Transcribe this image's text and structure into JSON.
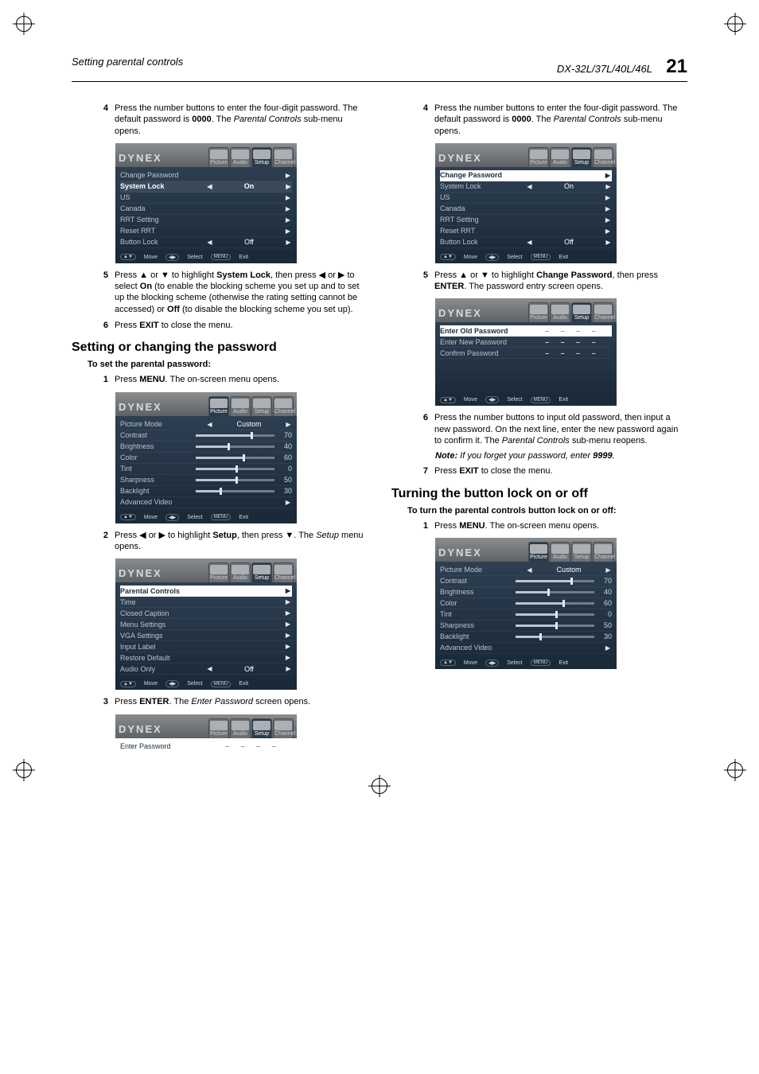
{
  "header": {
    "left": "Setting parental controls",
    "right_model": "DX-32L/37L/40L/46L",
    "page_number": "21"
  },
  "brand": "DYNEX",
  "tabs": {
    "picture": "Picture",
    "audio": "Audio",
    "setup": "Setup",
    "channel": "Channel"
  },
  "footer": {
    "move": "Move",
    "select": "Select",
    "menu_btn": "MENU",
    "exit": "Exit"
  },
  "parental": {
    "change_password": "Change Password",
    "system_lock": "System Lock",
    "system_lock_value": "On",
    "us": "US",
    "canada": "Canada",
    "rrt_setting": "RRT Setting",
    "reset_rrt": "Reset RRT",
    "button_lock": "Button Lock",
    "button_lock_value": "Off"
  },
  "picture": {
    "mode": "Picture Mode",
    "mode_value": "Custom",
    "contrast": "Contrast",
    "contrast_v": "70",
    "brightness": "Brightness",
    "brightness_v": "40",
    "color": "Color",
    "color_v": "60",
    "tint": "Tint",
    "tint_v": "0",
    "sharpness": "Sharpness",
    "sharpness_v": "50",
    "backlight": "Backlight",
    "backlight_v": "30",
    "advanced": "Advanced Video"
  },
  "setup_menu": {
    "parental_controls": "Parental Controls",
    "time": "Time",
    "closed_caption": "Closed   Caption",
    "menu_settings": "Menu Settings",
    "vga_settings": "VGA  Settings",
    "input_label": "Input Label",
    "restore_default": "Restore Default",
    "audio_only": "Audio Only",
    "audio_only_value": "Off"
  },
  "enter_pw": {
    "enter_password": "Enter  Password",
    "enter_old": "Enter  Old  Password",
    "enter_new": "Enter New Password",
    "confirm": "Confirm Password"
  },
  "left_col": {
    "step4": "Press the number buttons to enter the four-digit password. The default password is <b>0000</b>. The <i>Parental Controls</i> sub-menu opens.",
    "step5": "Press ▲ or ▼ to highlight <b>System Lock</b>, then press ◀ or ▶ to select <b>On</b> (to enable the blocking scheme you set up and to set up the blocking scheme (otherwise the rating setting cannot be accessed) or <b>Off</b> (to disable the blocking scheme you set up).",
    "step6": "Press <b>EXIT</b> to close the menu.",
    "section_title": "Setting or changing the password",
    "subhead": "To set the parental password:",
    "step1": "Press <b>MENU</b>. The on-screen menu opens.",
    "step2": "Press ◀ or ▶ to highlight <b>Setup</b>, then press ▼. The <i>Setup</i> menu opens.",
    "step3": "Press <b>ENTER</b>. The <i>Enter Password</i> screen opens."
  },
  "right_col": {
    "step4": "Press the number buttons to enter the four-digit password. The default password is <b>0000</b>. The <i>Parental Controls</i> sub-menu opens.",
    "step5": "Press ▲ or ▼ to highlight <b>Change Password</b>, then press <b>ENTER</b>. The password entry screen opens.",
    "step6": "Press the number buttons to input old password, then input a new password. On the next line, enter the new password again to confirm it. The <i>Parental Controls</i> sub-menu reopens.",
    "note": "<b>Note:</b> <i>If you forget your password, enter</i> <b>9999</b>.",
    "step7": "Press <b>EXIT</b> to close the menu.",
    "section_title": "Turning the button lock on or off",
    "subhead": "To turn the parental controls button lock on or off:",
    "step1": "Press <b>MENU</b>. The on-screen menu opens."
  }
}
